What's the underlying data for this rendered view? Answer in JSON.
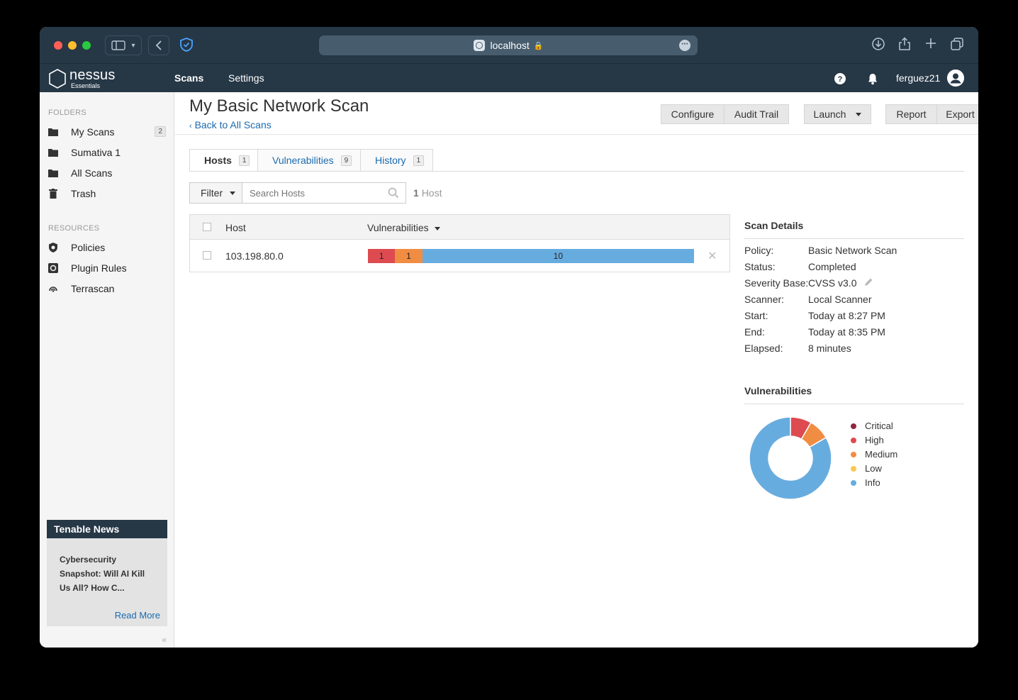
{
  "browser": {
    "url": "localhost"
  },
  "header": {
    "brand": "nessus",
    "edition": "Essentials",
    "nav": {
      "scans": "Scans",
      "settings": "Settings"
    },
    "username": "ferguez21"
  },
  "sidebar": {
    "folders_heading": "FOLDERS",
    "folders": [
      {
        "label": "My Scans",
        "count": "2",
        "icon": "folder-icon"
      },
      {
        "label": "Sumativa 1",
        "icon": "folder-icon"
      },
      {
        "label": "All Scans",
        "icon": "folder-icon"
      },
      {
        "label": "Trash",
        "icon": "trash-icon"
      }
    ],
    "resources_heading": "RESOURCES",
    "resources": [
      {
        "label": "Policies",
        "icon": "shield-icon"
      },
      {
        "label": "Plugin Rules",
        "icon": "plugin-icon"
      },
      {
        "label": "Terrascan",
        "icon": "terrascan-icon"
      }
    ],
    "news": {
      "title": "Tenable News",
      "body": "Cybersecurity Snapshot: Will AI Kill Us All? How C...",
      "read_more": "Read More"
    }
  },
  "main": {
    "title": "My Basic Network Scan",
    "back_link": "Back to All Scans",
    "toolbar": {
      "configure": "Configure",
      "audit_trail": "Audit Trail",
      "launch": "Launch",
      "report": "Report",
      "export": "Export"
    },
    "tabs": [
      {
        "label": "Hosts",
        "count": "1"
      },
      {
        "label": "Vulnerabilities",
        "count": "9"
      },
      {
        "label": "History",
        "count": "1"
      }
    ],
    "filter_label": "Filter",
    "search_placeholder": "Search Hosts",
    "host_count_num": "1",
    "host_count_label": "Host",
    "table": {
      "col_host": "Host",
      "col_vulns": "Vulnerabilities",
      "rows": [
        {
          "host": "103.198.80.0",
          "bar": [
            {
              "severity": "high",
              "count": 1,
              "label": "1"
            },
            {
              "severity": "medium",
              "count": 1,
              "label": "1"
            },
            {
              "severity": "info",
              "count": 10,
              "label": "10"
            }
          ]
        }
      ]
    },
    "scan_details": {
      "title": "Scan Details",
      "rows": [
        {
          "key": "Policy:",
          "value": "Basic Network Scan"
        },
        {
          "key": "Status:",
          "value": "Completed"
        },
        {
          "key": "Severity Base:",
          "value": "CVSS v3.0"
        },
        {
          "key": "Scanner:",
          "value": "Local Scanner"
        },
        {
          "key": "Start:",
          "value": "Today at 8:27 PM"
        },
        {
          "key": "End:",
          "value": "Today at 8:35 PM"
        },
        {
          "key": "Elapsed:",
          "value": "8 minutes"
        }
      ]
    },
    "vuln_chart": {
      "title": "Vulnerabilities",
      "legend": [
        "Critical",
        "High",
        "Medium",
        "Low",
        "Info"
      ]
    }
  },
  "colors": {
    "critical": "#91243e",
    "high": "#dd4b50",
    "medium": "#f18c43",
    "low": "#f8c851",
    "info": "#67acdf",
    "header_bg": "#263746",
    "link": "#1a6aaf"
  },
  "chart_data": {
    "type": "pie",
    "categories": [
      "Critical",
      "High",
      "Medium",
      "Low",
      "Info"
    ],
    "values": [
      0,
      1,
      1,
      0,
      10
    ]
  }
}
